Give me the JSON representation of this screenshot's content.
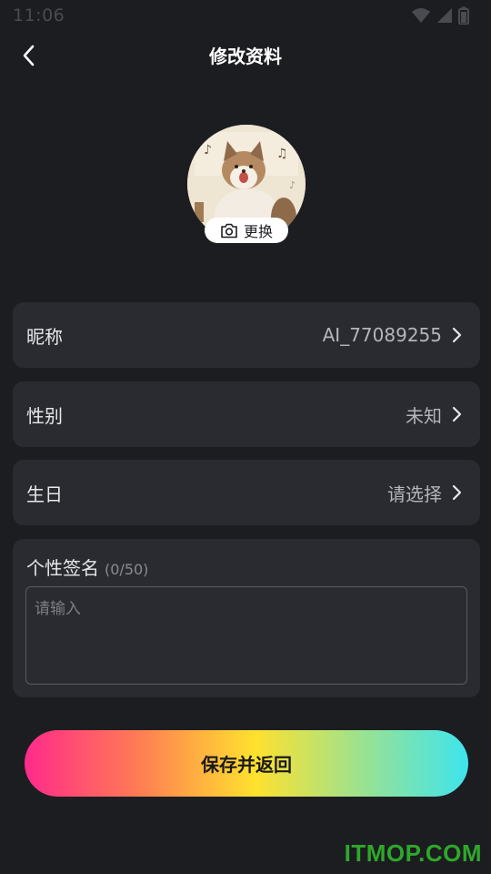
{
  "status_bar": {
    "time": "11:06",
    "icons": [
      "wifi-icon",
      "signal-icon",
      "battery-icon"
    ]
  },
  "header": {
    "title": "修改资料",
    "back_icon": "chevron-left-icon"
  },
  "avatar": {
    "change_label": "更换",
    "change_icon": "camera-icon"
  },
  "fields": {
    "nickname": {
      "label": "昵称",
      "value": "AI_77089255"
    },
    "gender": {
      "label": "性别",
      "value": "未知"
    },
    "birthday": {
      "label": "生日",
      "value": "请选择"
    }
  },
  "signature": {
    "label": "个性签名",
    "count": "(0/50)",
    "placeholder": "请输入",
    "value": ""
  },
  "save_button": {
    "label": "保存并返回"
  },
  "watermark": {
    "text": "ITMOP.COM"
  },
  "colors": {
    "background": "#1c1d21",
    "card": "#2a2b30",
    "gradient": [
      "#ff2a8a",
      "#ffe12e",
      "#3ee4ee"
    ],
    "watermark": "#2ea82a"
  }
}
